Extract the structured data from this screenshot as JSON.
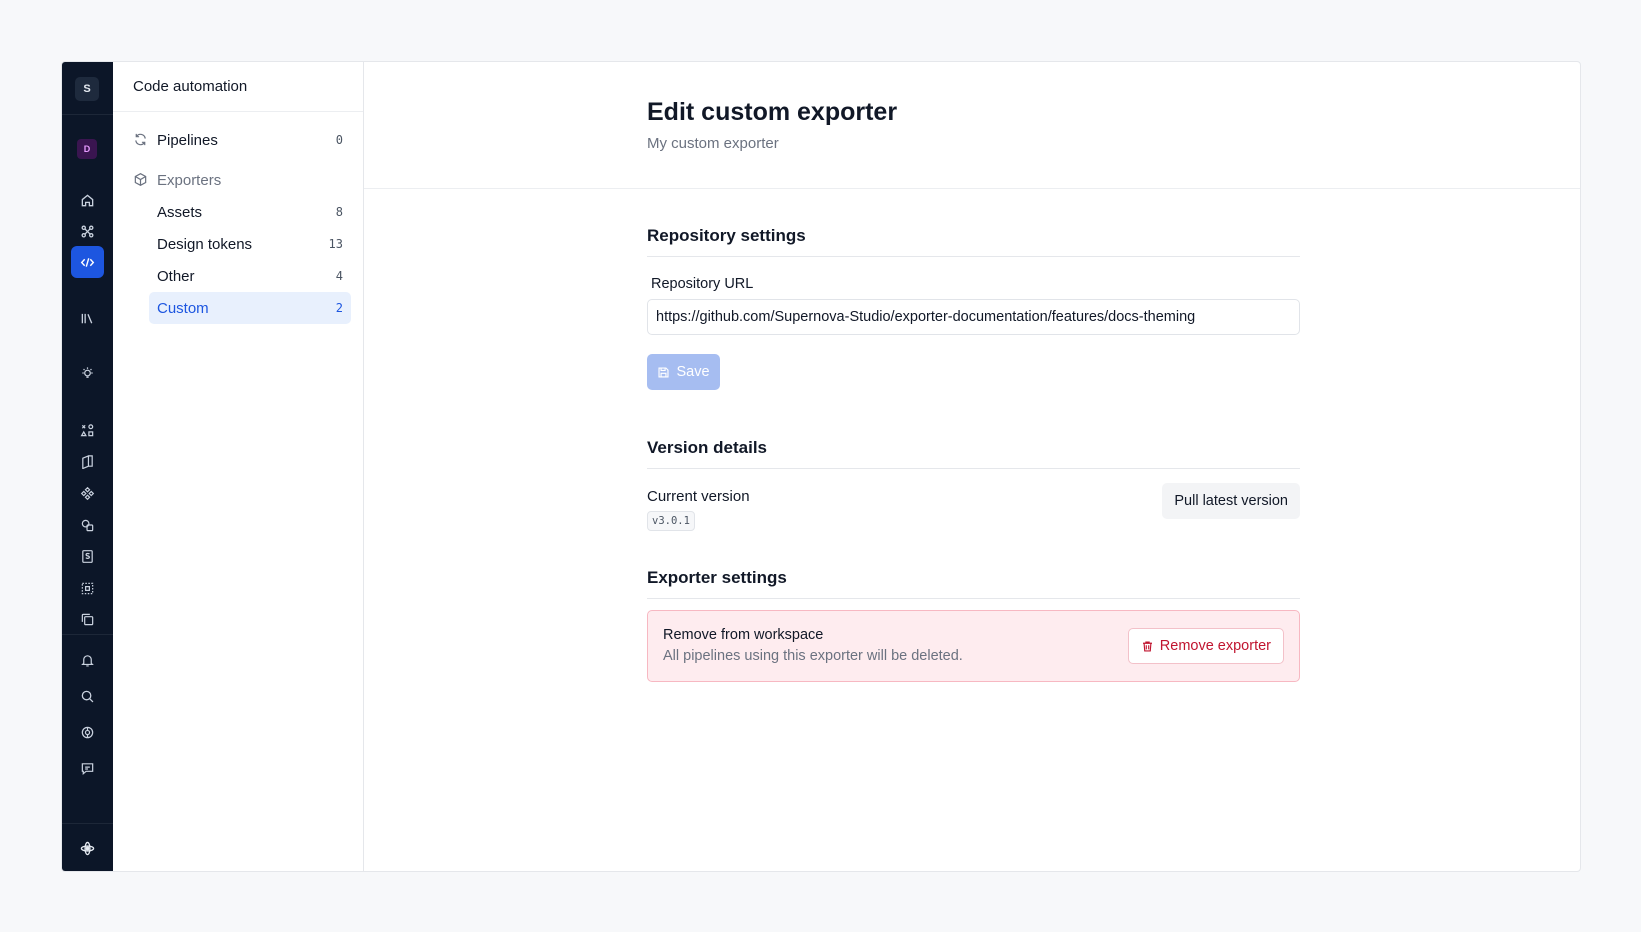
{
  "rail": {
    "workspace_initial": "S",
    "design_system_initial": "D",
    "items": [
      {
        "icon": "home-icon"
      },
      {
        "icon": "connections-icon"
      },
      {
        "icon": "code-icon",
        "active": true
      },
      {
        "icon": "library-icon"
      },
      {
        "icon": "lightbulb-icon"
      },
      {
        "icon": "shapes-icon"
      },
      {
        "icon": "docs-icon"
      },
      {
        "icon": "component-icon"
      },
      {
        "icon": "layers-icon"
      },
      {
        "icon": "storybook-icon"
      },
      {
        "icon": "frame-icon"
      },
      {
        "icon": "copy-icon"
      },
      {
        "icon": "bell-icon"
      },
      {
        "icon": "search-icon"
      },
      {
        "icon": "sync-icon"
      },
      {
        "icon": "chat-icon"
      },
      {
        "icon": "supernova-logo-icon"
      }
    ]
  },
  "sidebar": {
    "title": "Code automation",
    "pipelines": {
      "label": "Pipelines",
      "count": "0"
    },
    "exporters": {
      "label": "Exporters"
    },
    "items": [
      {
        "label": "Assets",
        "count": "8"
      },
      {
        "label": "Design tokens",
        "count": "13"
      },
      {
        "label": "Other",
        "count": "4"
      },
      {
        "label": "Custom",
        "count": "2",
        "active": true
      }
    ]
  },
  "page": {
    "title": "Edit custom exporter",
    "subtitle": "My custom exporter"
  },
  "repository": {
    "section_title": "Repository settings",
    "url_label": "Repository URL",
    "url_value": "https://github.com/Supernova-Studio/exporter-documentation/features/docs-theming",
    "save_label": "Save"
  },
  "version": {
    "section_title": "Version details",
    "current_label": "Current version",
    "current_value": "v3.0.1",
    "pull_label": "Pull latest version"
  },
  "exporter_settings": {
    "section_title": "Exporter settings",
    "danger_title": "Remove from workspace",
    "danger_desc": "All pipelines using this exporter will be deleted.",
    "remove_label": "Remove exporter"
  },
  "colors": {
    "accent": "#1d56e0",
    "rail_bg": "#0c1628",
    "danger": "#c0142f",
    "danger_bg": "#feecef"
  }
}
